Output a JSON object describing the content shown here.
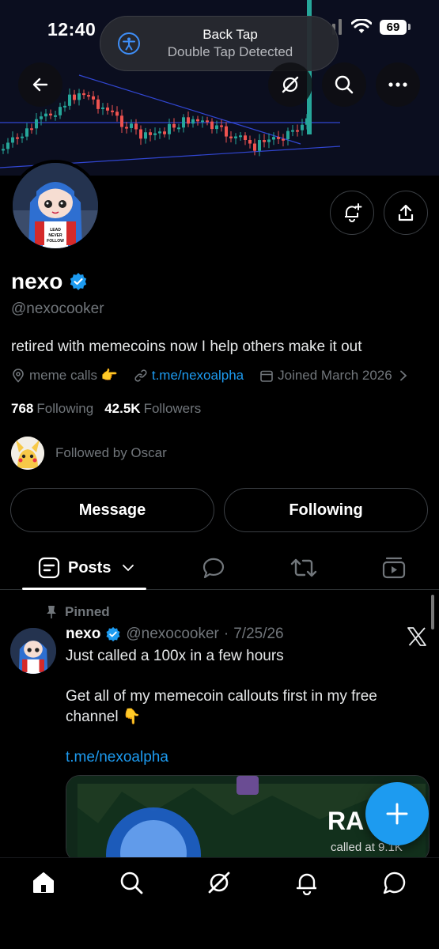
{
  "status_bar": {
    "time": "12:40",
    "battery": "69"
  },
  "toast": {
    "title": "Back Tap",
    "subtitle": "Double Tap Detected"
  },
  "profile": {
    "name": "nexo",
    "handle": "@nexocooker",
    "bio": "retired with memecoins now I help others make it out",
    "location": "meme calls 👉",
    "website": "t.me/nexoalpha",
    "joined": "Joined March 2026",
    "following_count": "768",
    "following_label": "Following",
    "followers_count": "42.5K",
    "followers_label": "Followers",
    "followed_by": "Followed by Oscar",
    "avatar_shirt_text": "LEAD NEVER FOLLOW"
  },
  "actions": {
    "message": "Message",
    "following": "Following"
  },
  "tabs": {
    "posts": "Posts"
  },
  "post": {
    "pinned_label": "Pinned",
    "author_name": "nexo",
    "author_handle": "@nexocooker",
    "date": "7/25/26",
    "line1": "Just called a 100x in a few hours",
    "line2": "Get all of my memecoin callouts first in my free",
    "line3": "channel 👇",
    "link": "t.me/nexoalpha",
    "media_title": "RA",
    "media_caption": "called at 9.1K"
  },
  "colors": {
    "accent": "#1d9bf0",
    "verified": "#1d9bf0",
    "background": "#000000"
  },
  "icons": [
    "back-arrow-icon",
    "grok-icon",
    "search-icon",
    "more-icon",
    "notify-bell-icon",
    "share-icon",
    "verified-badge-icon",
    "location-icon",
    "link-icon",
    "calendar-icon",
    "chevron-right-icon",
    "posts-tab-icon",
    "chevron-down-icon",
    "replies-icon",
    "retweet-icon",
    "media-icon",
    "pin-icon",
    "x-logo-icon",
    "plus-icon",
    "home-icon",
    "explore-icon",
    "grok-nav-icon",
    "notifications-icon",
    "messages-icon"
  ]
}
